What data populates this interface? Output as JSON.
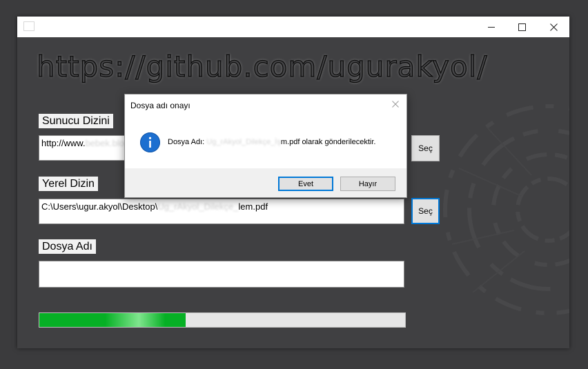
{
  "window": {
    "app_icon": "app-icon",
    "controls": [
      "minimize-icon",
      "maximize-icon",
      "close-icon"
    ]
  },
  "banner": {
    "text": "https://github.com/ugurakyol/"
  },
  "fields": {
    "server_dir": {
      "label": "Sunucu Dizini",
      "value_prefix": "http://www.",
      "value_hidden": "bebek.blog.tr"
    },
    "local_dir": {
      "label": "Yerel Dizin",
      "value_prefix": "C:\\Users\\ugur.akyol\\Desktop\\",
      "value_hidden": "Ug_rAkyol_Dilekçe_",
      "value_suffix": "lem.pdf"
    },
    "file_name": {
      "label": "Dosya Adı",
      "value": ""
    }
  },
  "buttons": {
    "sec_label": "Seç"
  },
  "progress": {
    "value_fraction": 0.4,
    "colors": {
      "fill": "#06b025",
      "track": "#e6e6e6"
    }
  },
  "dialog": {
    "title": "Dosya adı onayı",
    "message_prefix": "Dosya Adı: ",
    "message_hidden": "Ug_rAkyol_Dilekçe_İş",
    "message_suffix": "m.pdf olarak gönderilecektir.",
    "icon": "info-icon",
    "yes_label": "Evet",
    "no_label": "Hayır"
  },
  "colors": {
    "accent": "#0078d7",
    "info_icon": "#1c6fd0",
    "background": "#404042"
  }
}
